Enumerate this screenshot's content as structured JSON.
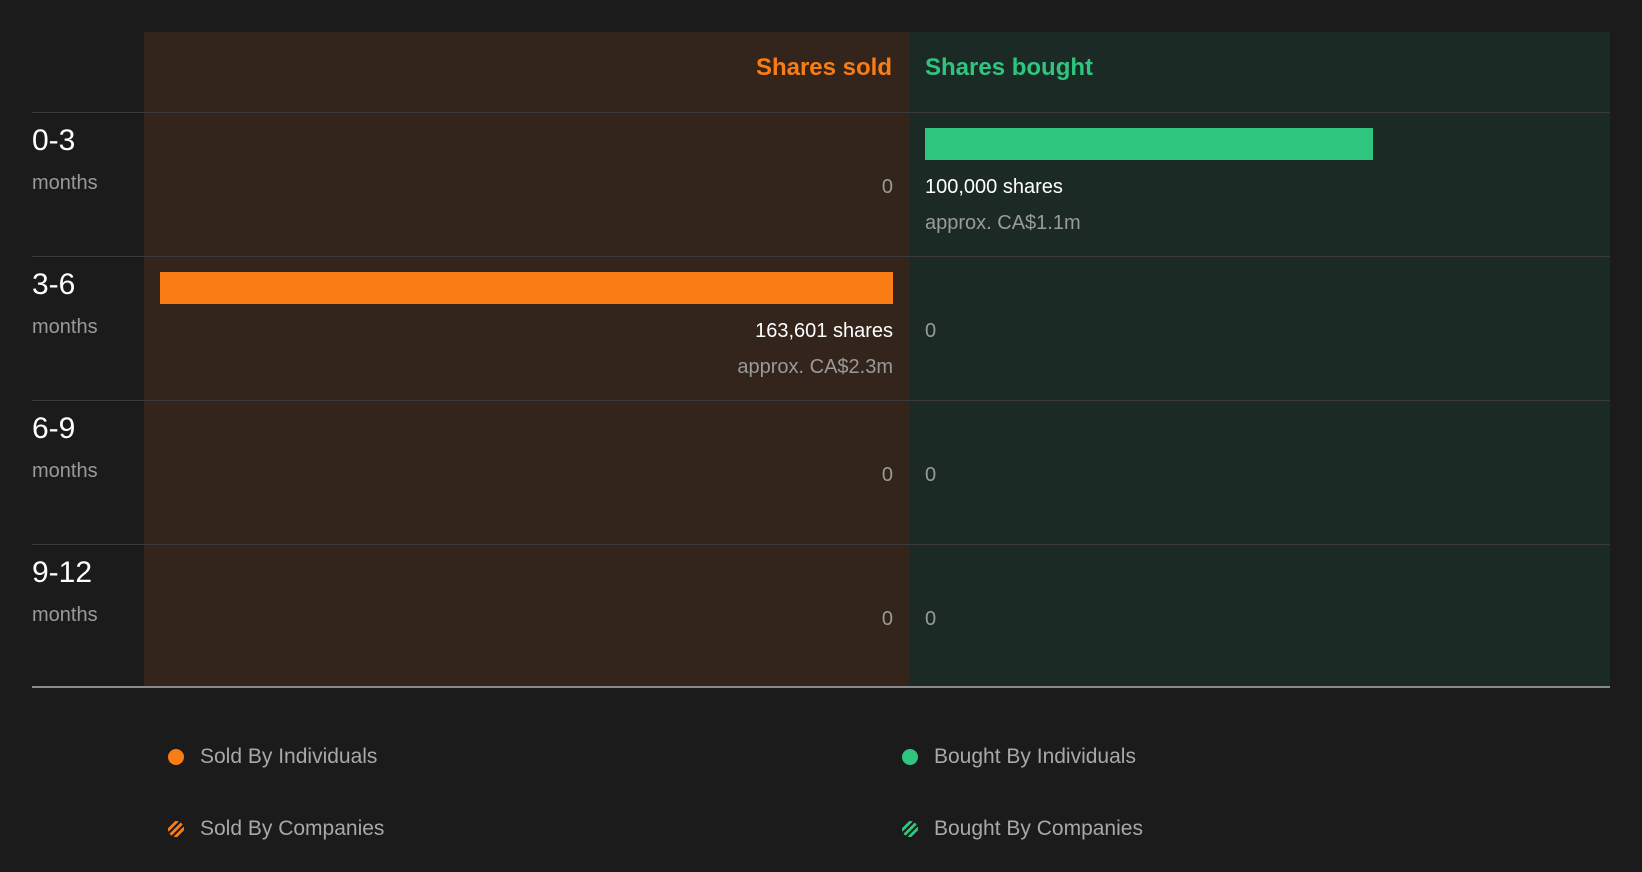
{
  "chart_data": {
    "type": "bar",
    "headers": {
      "sold": "Shares sold",
      "bought": "Shares bought"
    },
    "max_shares": 163601,
    "rows": [
      {
        "period": "0-3",
        "unit": "months",
        "sold_shares": 0,
        "sold_label": "0",
        "sold_approx": "",
        "bought_shares": 100000,
        "bought_label": "100,000 shares",
        "bought_approx": "approx. CA$1.1m"
      },
      {
        "period": "3-6",
        "unit": "months",
        "sold_shares": 163601,
        "sold_label": "163,601 shares",
        "sold_approx": "approx. CA$2.3m",
        "bought_shares": 0,
        "bought_label": "0",
        "bought_approx": ""
      },
      {
        "period": "6-9",
        "unit": "months",
        "sold_shares": 0,
        "sold_label": "0",
        "sold_approx": "",
        "bought_shares": 0,
        "bought_label": "0",
        "bought_approx": ""
      },
      {
        "period": "9-12",
        "unit": "months",
        "sold_shares": 0,
        "sold_label": "0",
        "sold_approx": "",
        "bought_shares": 0,
        "bought_label": "0",
        "bought_approx": ""
      }
    ],
    "legend": [
      {
        "label": "Sold By Individuals",
        "color": "#f97d14",
        "style": "solid"
      },
      {
        "label": "Bought By Individuals",
        "color": "#2ec67e",
        "style": "solid"
      },
      {
        "label": "Sold By Companies",
        "color": "#f97d14",
        "style": "striped"
      },
      {
        "label": "Bought By Companies",
        "color": "#2ec67e",
        "style": "striped"
      }
    ],
    "colors": {
      "sold": "#f97d14",
      "bought": "#2ec67e",
      "sold_bg": "#33241c",
      "bought_bg": "#1c2a25",
      "background": "#1b1b1b"
    }
  }
}
